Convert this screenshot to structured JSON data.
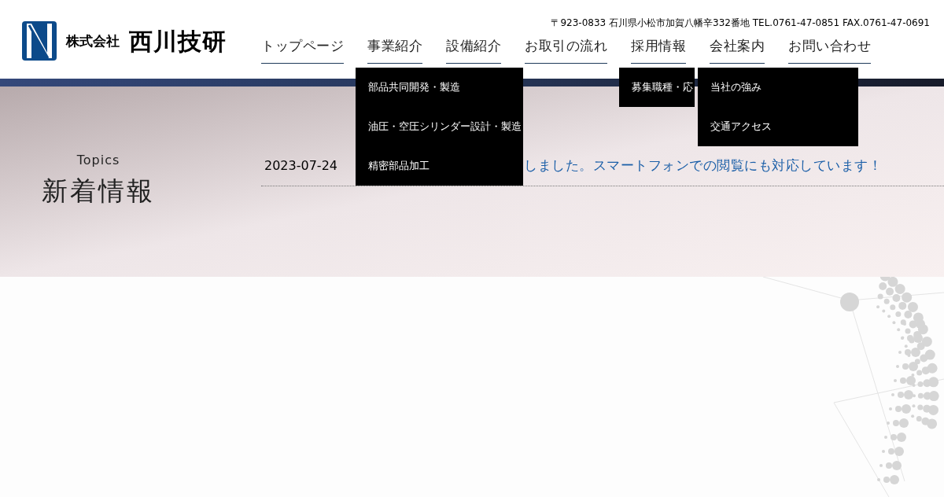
{
  "header": {
    "logo_small": "株式会社",
    "logo_large": "西川技研",
    "address": "〒923-0833 石川県小松市加賀八幡辛332番地 TEL.0761-47-0851 FAX.0761-47-0691"
  },
  "nav": [
    {
      "label": "トップページ"
    },
    {
      "label": "事業紹介",
      "submenu": [
        "部品共同開発・製造",
        "油圧・空圧シリンダー設計・製造",
        "精密部品加工"
      ]
    },
    {
      "label": "設備紹介"
    },
    {
      "label": "お取引の流れ"
    },
    {
      "label": "採用情報",
      "submenu": [
        "募集職種・応"
      ]
    },
    {
      "label": "会社案内",
      "submenu": [
        "当社の強み",
        "交通アクセス"
      ]
    },
    {
      "label": "お問い合わせ"
    }
  ],
  "hero": {
    "label": "Topics",
    "title": "新着情報"
  },
  "news": [
    {
      "date": "2023-07-24",
      "text": "しました。スマートフォンでの閲覧にも対応しています！"
    }
  ]
}
